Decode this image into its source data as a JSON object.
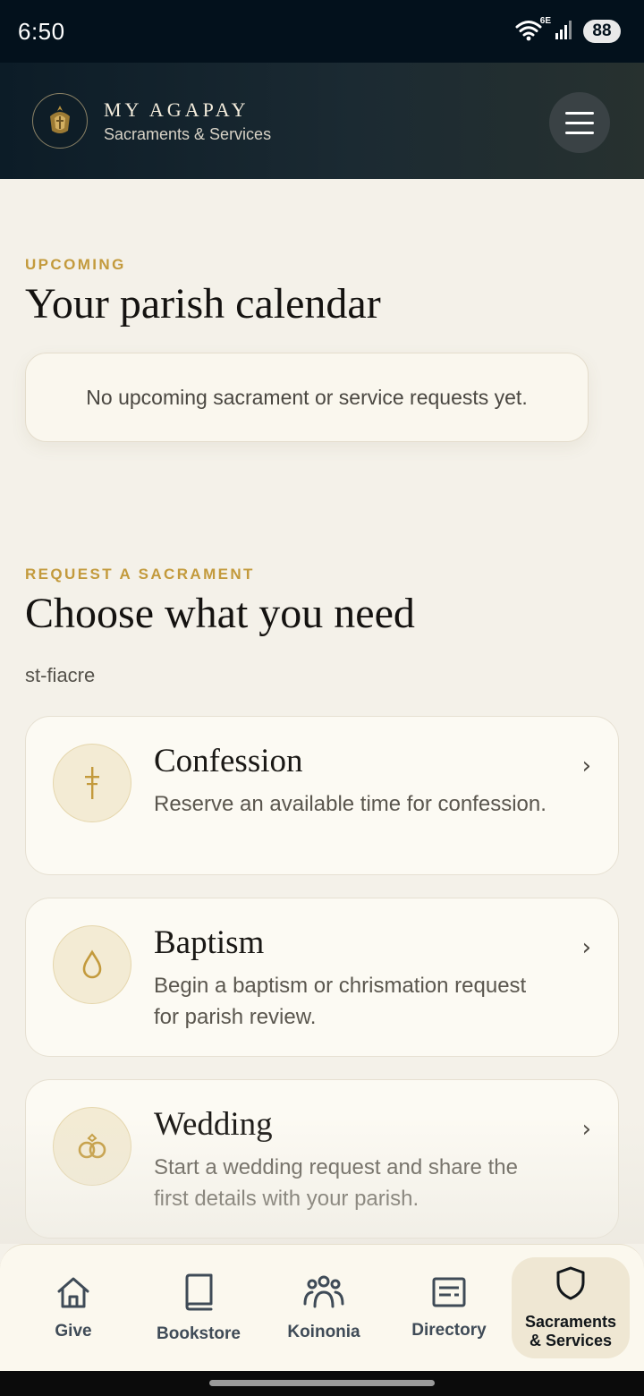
{
  "status_bar": {
    "time": "6:50",
    "network_tag": "6E",
    "battery": "88",
    "icons": [
      "wifi-icon",
      "signal-icon",
      "battery-icon"
    ]
  },
  "header": {
    "brand_name": "MY AGAPAY",
    "subtitle": "Sacraments & Services",
    "logo_icon": "parish-logo-icon",
    "menu_icon": "hamburger-menu-icon"
  },
  "upcoming": {
    "eyebrow": "UPCOMING",
    "title": "Your parish calendar",
    "empty_message": "No upcoming sacrament or service requests yet."
  },
  "request": {
    "eyebrow": "REQUEST A SACRAMENT",
    "title": "Choose what you need",
    "parish_slug": "st-fiacre",
    "services": [
      {
        "title": "Confession",
        "description": "Reserve an available time for confession.",
        "icon": "cross-icon",
        "chevron": "›"
      },
      {
        "title": "Baptism",
        "description": "Begin a baptism or chrismation request for parish review.",
        "icon": "water-drop-icon",
        "chevron": "›"
      },
      {
        "title": "Wedding",
        "description": "Start a wedding request and share the first details with your parish.",
        "icon": "rings-icon",
        "chevron": "›"
      }
    ]
  },
  "bottom_nav": {
    "items": [
      {
        "label": "Give",
        "icon": "home-icon",
        "active": false
      },
      {
        "label": "Bookstore",
        "icon": "book-icon",
        "active": false
      },
      {
        "label": "Koinonia",
        "icon": "community-icon",
        "active": false
      },
      {
        "label": "Directory",
        "icon": "directory-icon",
        "active": false
      },
      {
        "label": "Sacraments\n& Services",
        "icon": "shield-icon",
        "active": true
      }
    ]
  },
  "colors": {
    "accent_gold": "#c39a3c",
    "header_bg": "#0c1c27",
    "page_bg": "#f4f1e9",
    "card_bg": "#fcfaf3",
    "active_nav_bg": "#efe7d3"
  }
}
